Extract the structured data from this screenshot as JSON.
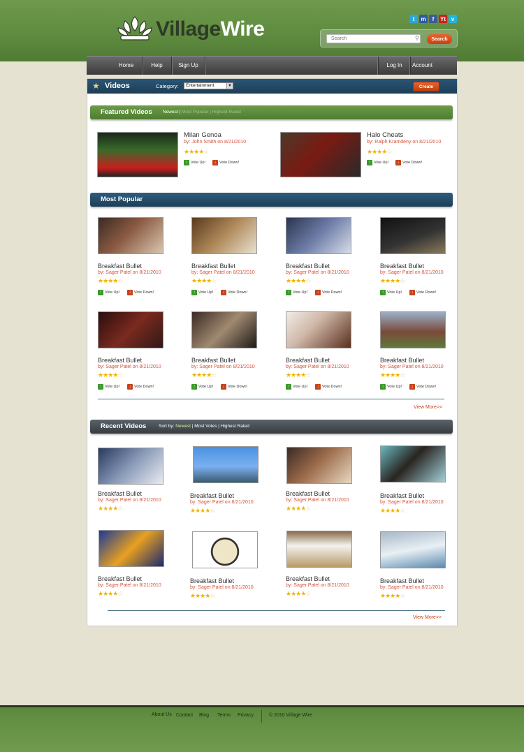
{
  "brand": {
    "village": "Village",
    "wire": "Wire"
  },
  "social": [
    {
      "name": "twitter",
      "glyph": "t",
      "color": "#2ea6d8"
    },
    {
      "name": "myspace",
      "glyph": "m",
      "color": "#2d5aa5"
    },
    {
      "name": "facebook",
      "glyph": "f",
      "color": "#3b5b98"
    },
    {
      "name": "youtube",
      "glyph": "Yt",
      "color": "#c8221c"
    },
    {
      "name": "vimeo",
      "glyph": "v",
      "color": "#1fb5e0"
    }
  ],
  "search": {
    "placeholder": "Search",
    "button": "Search"
  },
  "nav": {
    "home": "Home",
    "help": "Help",
    "signup": "Sign Up",
    "login": "Log In",
    "account": "Account"
  },
  "videos_bar": {
    "title": "Videos",
    "category_label": "Category:",
    "category_value": "Entertainment",
    "create": "Create"
  },
  "featured": {
    "title": "Featured Videos",
    "filter_active": "Newest",
    "filter_2": "Most Popular",
    "filter_3": "Highest Rated",
    "items": [
      {
        "title": "Milan Genoa",
        "by": "by: John Smith on 8/21/2010",
        "rating": 4,
        "vote_up": "Vote Up!",
        "vote_down": "Vote Down!"
      },
      {
        "title": "Halo Cheats",
        "by": "by: Ralph Kramdeny on 8/21/2010",
        "rating": 4,
        "vote_up": "Vote Up!",
        "vote_down": "Vote Down!"
      }
    ]
  },
  "popular": {
    "title": "Most Popular",
    "view_more": "View More>>",
    "items": [
      {
        "title": "Breakfast Bullet",
        "by": "by: Sager Patel on 8/21/2010",
        "rating": 4,
        "vote_up": "Vote Up!",
        "vote_down": "Vote Down!"
      },
      {
        "title": "Breakfast Bullet",
        "by": "by: Sager Patel on 8/21/2010",
        "rating": 4,
        "vote_up": "Vote Up!",
        "vote_down": "Vote Down!"
      },
      {
        "title": "Breakfast Bullet",
        "by": "by: Sager Patel on 8/21/2010",
        "rating": 4,
        "vote_up": "Vote Up!",
        "vote_down": "Vote Down!"
      },
      {
        "title": "Breakfast Bullet",
        "by": "by: Sager Patel on 8/21/2010",
        "rating": 4,
        "vote_up": "Vote Up!",
        "vote_down": "Vote Down!"
      },
      {
        "title": "Breakfast Bullet",
        "by": "by: Sager Patel on 8/21/2010",
        "rating": 4,
        "vote_up": "Vote Up!",
        "vote_down": "Vote Down!"
      },
      {
        "title": "Breakfast Bullet",
        "by": "by: Sager Patel on 8/21/2010",
        "rating": 4,
        "vote_up": "Vote Up!",
        "vote_down": "Vote Down!"
      },
      {
        "title": "Breakfast Bullet",
        "by": "by: Sager Patel on 8/21/2010",
        "rating": 4,
        "vote_up": "Vote Up!",
        "vote_down": "Vote Down!"
      },
      {
        "title": "Breakfast Bullet",
        "by": "by: Sager Patel on 8/21/2010",
        "rating": 4,
        "vote_up": "Vote Up!",
        "vote_down": "Vote Down!"
      }
    ]
  },
  "recent": {
    "title": "Recent Videos",
    "sort_label": "Sort by:",
    "sort_active": "Newest",
    "sort_2": "Most Votes",
    "sort_3": "Highest Rated",
    "view_more": "View More>>",
    "items": [
      {
        "title": "Breakfast Bullet",
        "by": "by: Sager Patel on 8/21/2010",
        "rating": 4
      },
      {
        "title": "Breakfast Bullet",
        "by": "by: Sager Patel on 8/21/2010",
        "rating": 4
      },
      {
        "title": "Breakfast Bullet",
        "by": "by: Sager Patel on 8/21/2010",
        "rating": 4
      },
      {
        "title": "Breakfast Bullet",
        "by": "by: Sager Patel on 8/21/2010",
        "rating": 4
      },
      {
        "title": "Breakfast Bullet",
        "by": "by: Sager Patel on 8/21/2010",
        "rating": 4
      },
      {
        "title": "Breakfast Bullet",
        "by": "by: Sager Patel on 8/21/2010",
        "rating": 4
      },
      {
        "title": "Breakfast Bullet",
        "by": "by: Sager Patel on 8/21/2010",
        "rating": 4
      },
      {
        "title": "Breakfast Bullet",
        "by": "by: Sager Patel on 8/21/2010",
        "rating": 4
      }
    ]
  },
  "footer": {
    "about": "About Us",
    "contact": "Contact",
    "blog": "Blog",
    "terms": "Terms",
    "privacy": "Privacy",
    "copyright": "© 2010 Village Wire"
  }
}
